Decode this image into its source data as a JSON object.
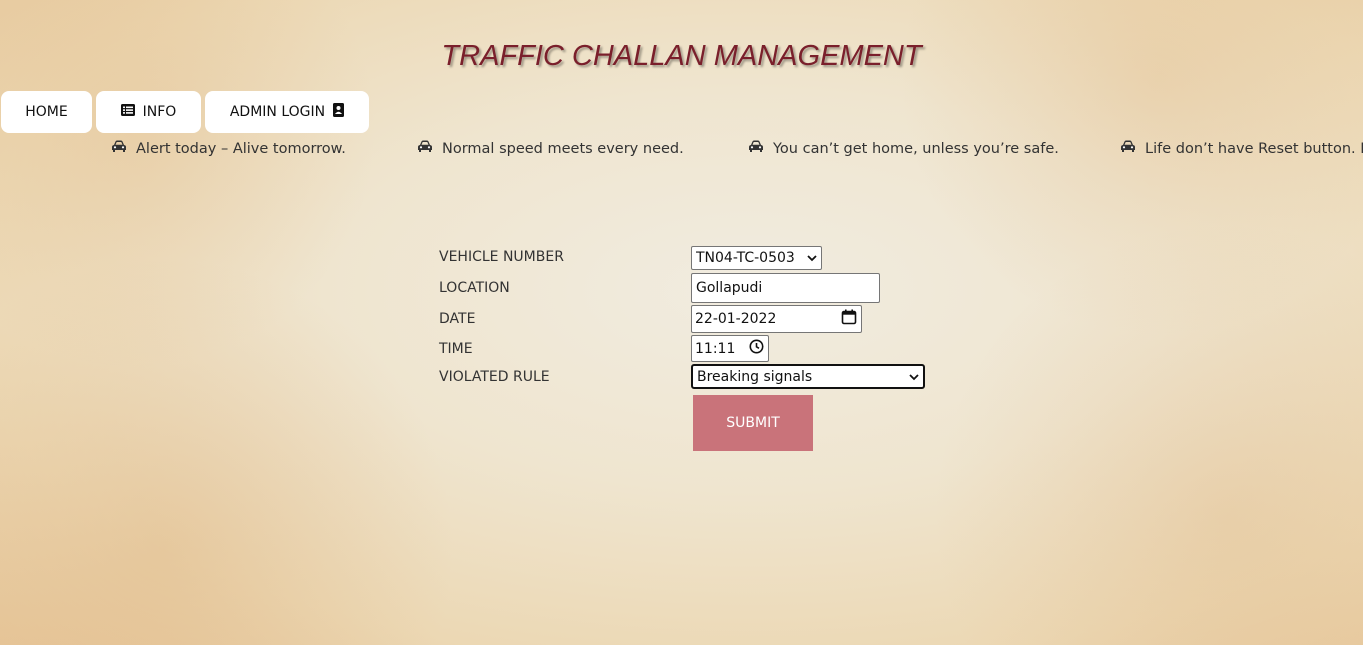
{
  "header": {
    "title": "TRAFFIC CHALLAN MANAGEMENT"
  },
  "nav": {
    "home_label": "HOME",
    "info_label": "INFO",
    "admin_label": "ADMIN LOGIN"
  },
  "slogans": [
    "Alert today – Alive tomorrow.",
    "Normal speed meets every need.",
    "You can’t get home, unless you’re safe.",
    "Life don’t have Reset button. D"
  ],
  "form": {
    "vehicle_number": {
      "label": "VEHICLE NUMBER",
      "value": "TN04-TC-0503"
    },
    "location": {
      "label": "LOCATION",
      "value": "Gollapudi"
    },
    "date": {
      "label": "DATE",
      "value": "22-01-2022"
    },
    "time": {
      "label": "TIME",
      "value": "11:11"
    },
    "violated_rule": {
      "label": "VIOLATED RULE",
      "value": "Breaking signals"
    },
    "submit_label": "SUBMIT"
  },
  "icons": {
    "info": "list-icon",
    "admin": "contact-card-icon",
    "slogan": "car-icon"
  },
  "colors": {
    "title": "#7a1f2b",
    "submit_bg": "#c9737a"
  }
}
